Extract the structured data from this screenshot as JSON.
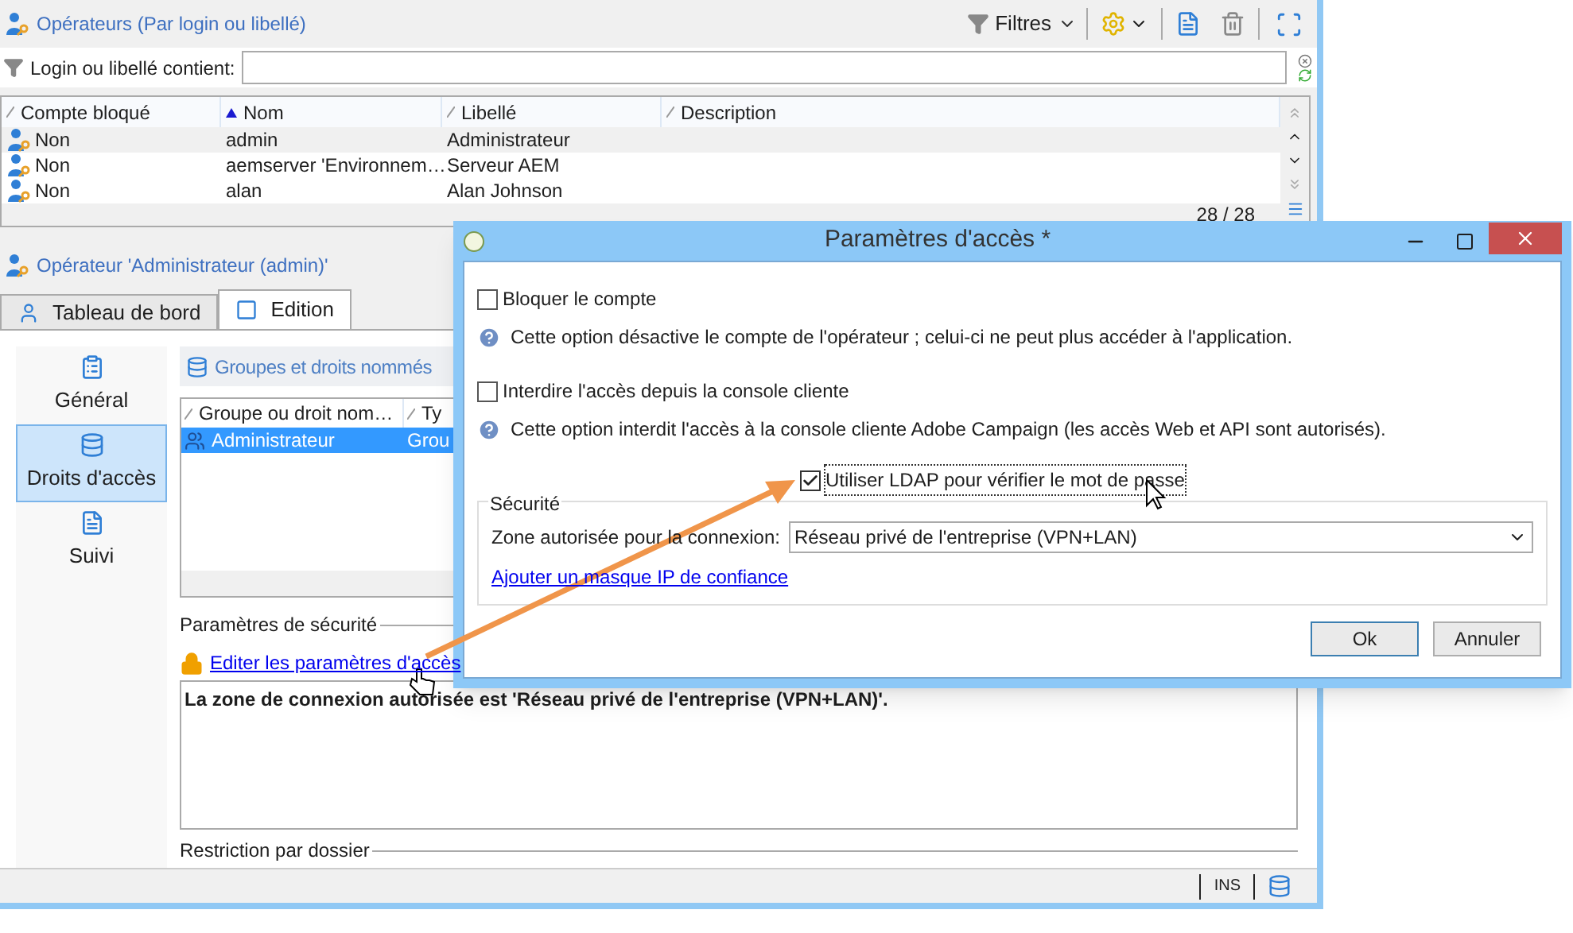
{
  "operators_panel": {
    "title": "Opérateurs (Par login ou libellé)",
    "filter_button": "Filtres",
    "filter": {
      "label": "Login ou libellé contient:"
    },
    "table": {
      "columns": [
        {
          "label": "Compte bloqué",
          "sorted": false
        },
        {
          "label": "Nom",
          "sorted": true
        },
        {
          "label": "Libellé",
          "sorted": false
        },
        {
          "label": "Description",
          "sorted": false
        }
      ],
      "rows": [
        {
          "cells": [
            "Non",
            "admin",
            "Administrateur"
          ],
          "selected": true
        },
        {
          "cells": [
            "Non",
            "aemserver 'Environnem…",
            "Serveur AEM"
          ],
          "selected": false
        },
        {
          "cells": [
            "Non",
            "alan",
            "Alan Johnson"
          ],
          "selected": false
        }
      ],
      "count": "28 / 28"
    }
  },
  "operator_panel": {
    "title": "Opérateur 'Administrateur (admin)'",
    "tabs": [
      {
        "label": "Tableau de bord",
        "selected": false
      },
      {
        "label": "Edition",
        "selected": true
      }
    ],
    "nav": [
      {
        "label": "Général",
        "selected": false
      },
      {
        "label": "Droits d'accès",
        "selected": true
      },
      {
        "label": "Suivi",
        "selected": false
      }
    ],
    "groups": {
      "title": "Groupes et droits nommés",
      "columns": [
        "Groupe ou droit nom…",
        "Ty"
      ],
      "rows": [
        {
          "cells": [
            "Administrateur",
            "Grou"
          ],
          "selected": true
        }
      ]
    },
    "security": {
      "title": "Paramètres de sécurité",
      "link": "Editer les paramètres d'accès",
      "summary": "La zone de connexion autorisée est 'Réseau privé de l'entreprise (VPN+LAN)'."
    },
    "restriction_title": "Restriction par dossier"
  },
  "status_bar": {
    "mode": "INS"
  },
  "dialog": {
    "title": "Paramètres d'accès *",
    "options": [
      {
        "kind": "checkbox",
        "label": "Bloquer le compte",
        "checked": false
      },
      {
        "kind": "help",
        "text": "Cette option désactive le compte de l'opérateur ; celui-ci ne peut plus accéder à l'application."
      },
      {
        "kind": "checkbox",
        "label": "Interdire l'accès depuis la console cliente",
        "checked": false
      },
      {
        "kind": "help",
        "text": "Cette option interdit l'accès à la console cliente Adobe Campaign (les accès Web et API sont autorisés)."
      },
      {
        "kind": "focused-checkbox",
        "label": "Utiliser LDAP pour vérifier le mot de passe",
        "checked": true
      }
    ],
    "security": {
      "title": "Sécurité",
      "zone_label": "Zone autorisée pour la connexion:",
      "zone_value": "Réseau privé de l'entreprise (VPN+LAN)",
      "link": "Ajouter un masque IP de confiance"
    },
    "buttons": [
      "Ok",
      "Annuler"
    ]
  }
}
